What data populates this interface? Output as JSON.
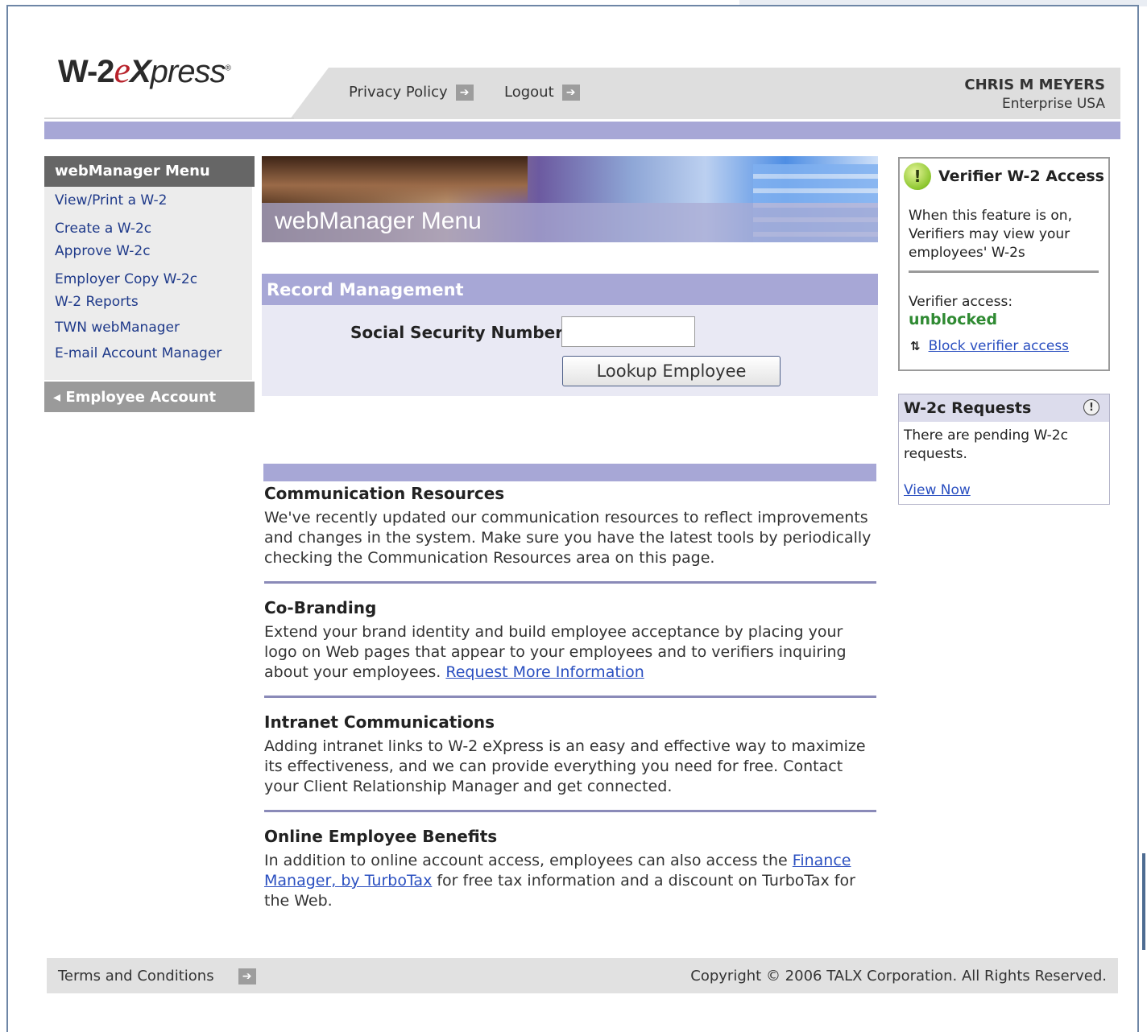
{
  "header": {
    "logo": {
      "w2": "W-2",
      "e": "e",
      "x": "X",
      "press": "press",
      "reg": "®"
    },
    "links": [
      {
        "label": "Privacy Policy",
        "icon": "arrow-right-icon"
      },
      {
        "label": "Logout",
        "icon": "arrow-right-icon"
      }
    ],
    "user": {
      "name": "CHRIS M MEYERS",
      "org": "Enterprise USA"
    }
  },
  "sidebar": {
    "title": "webManager Menu",
    "items": [
      {
        "label": "View/Print a W-2"
      },
      {
        "label": "Create a W-2c"
      },
      {
        "label": "Approve W-2c"
      },
      {
        "label": "Employer Copy W-2c"
      },
      {
        "label": "W-2 Reports"
      },
      {
        "label": "TWN webManager"
      },
      {
        "label": "E-mail Account Manager"
      }
    ],
    "footer": {
      "arrow": "◂",
      "label": "Employee Account"
    }
  },
  "banner": {
    "title": "webManager Menu"
  },
  "record": {
    "title": "Record Management",
    "ssn_label": "Social Security Number:",
    "ssn_value": "",
    "lookup_label": "Lookup Employee"
  },
  "sections": [
    {
      "title": "Communication Resources",
      "text": "We've recently updated our communication resources to reflect improvements and changes in the system. Make sure you have the latest tools by periodically checking the Communication Resources area on this page."
    },
    {
      "title": "Co-Branding",
      "text": "Extend your brand identity and build employee acceptance by placing your logo on Web pages that appear to your employees and to verifiers inquiring about your employees. ",
      "link": "Request More Information"
    },
    {
      "title": "Intranet Communications",
      "text": "Adding intranet links to W-2 eXpress is an easy and effective way to maximize its effectiveness, and we can provide everything you need for free. Contact your Client Relationship Manager and get connected."
    },
    {
      "title": "Online Employee Benefits",
      "text_before": "In addition to online account access, employees can also access the ",
      "link": "Finance Manager, by TurboTax",
      "text_after": " for free tax information and a discount on TurboTax for the Web."
    }
  ],
  "verifier": {
    "icon_glyph": "!",
    "title": "Verifier W-2 Access",
    "description": "When this feature is on, Verifiers may view your employees' W-2s",
    "access_label": "Verifier access:",
    "status": "unblocked",
    "swap_glyph": "⇅",
    "link": "Block verifier access"
  },
  "requests": {
    "title": "W-2c Requests",
    "icon_glyph": "!",
    "text": "There are pending W-2c requests.",
    "link": "View Now"
  },
  "footer": {
    "terms": "Terms and Conditions",
    "copyright": "Copyright © 2006 TALX Corporation. All Rights Reserved."
  },
  "colors": {
    "accent": "#a7a7d6",
    "link": "#2a4fc0",
    "status_green": "#2f8a32"
  }
}
